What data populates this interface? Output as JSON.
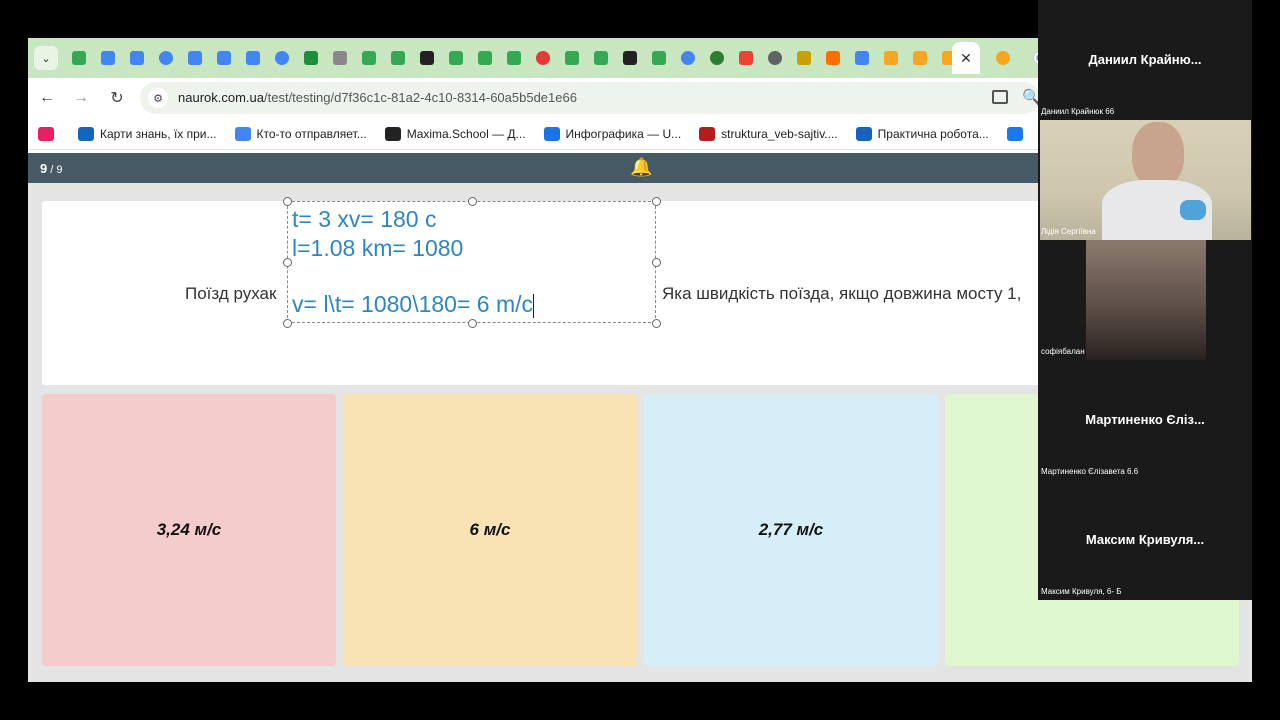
{
  "browser": {
    "tab_icons": [
      {
        "icon": "google-drive-icon",
        "color": "#34a853"
      },
      {
        "icon": "google-docs-icon",
        "color": "#4285f4"
      },
      {
        "icon": "google-docs-icon",
        "color": "#4285f4"
      },
      {
        "icon": "docs-circle-icon",
        "color": "#4285f4"
      },
      {
        "icon": "google-docs-icon",
        "color": "#4285f4"
      },
      {
        "icon": "google-docs-icon",
        "color": "#4285f4"
      },
      {
        "icon": "google-docs-icon",
        "color": "#4285f4"
      },
      {
        "icon": "docs-circle-icon",
        "color": "#4285f4"
      },
      {
        "icon": "green-plus-icon",
        "color": "#1e8e3e"
      },
      {
        "icon": "printer-icon",
        "color": "#888888"
      },
      {
        "icon": "google-drive-icon",
        "color": "#34a853"
      },
      {
        "icon": "google-drive-icon",
        "color": "#34a853"
      },
      {
        "icon": "d-letter-icon",
        "color": "#222222"
      },
      {
        "icon": "google-drive-icon",
        "color": "#34a853"
      },
      {
        "icon": "google-drive-icon",
        "color": "#34a853"
      },
      {
        "icon": "google-drive-icon",
        "color": "#34a853"
      },
      {
        "icon": "red-circle-icon",
        "color": "#e53935"
      },
      {
        "icon": "google-drive-icon",
        "color": "#34a853"
      },
      {
        "icon": "google-drive-icon",
        "color": "#34a853"
      },
      {
        "icon": "d-letter-icon",
        "color": "#222222"
      },
      {
        "icon": "google-drive-icon",
        "color": "#34a853"
      },
      {
        "icon": "docs-circle-icon",
        "color": "#4285f4"
      },
      {
        "icon": "loading-icon",
        "color": "#2e7d32"
      },
      {
        "icon": "gmail-icon",
        "color": "#ea4335"
      },
      {
        "icon": "globe-icon",
        "color": "#5f6368"
      },
      {
        "icon": "badge-icon",
        "color": "#c8a000"
      },
      {
        "icon": "grid-icon",
        "color": "#ff6f00"
      },
      {
        "icon": "google-g-icon",
        "color": "#4285f4"
      },
      {
        "icon": "bell-tab-icon",
        "color": "#f5a623"
      },
      {
        "icon": "bell-tab-icon",
        "color": "#f5a623"
      },
      {
        "icon": "bell-tab-icon",
        "color": "#f5a623"
      }
    ],
    "active_tab_close": "✕",
    "url_host": "naurok.com.ua",
    "url_path": "/test/testing/d7f36c1c-81a2-4c10-8314-60a5b5de1e66",
    "bookmarks": [
      {
        "label": "",
        "icon": "dna-icon",
        "color": "#e91e63"
      },
      {
        "label": "Карти знань, їх при...",
        "icon": "flag-icon",
        "color": "#1565c0"
      },
      {
        "label": "Кто-то отправляет...",
        "icon": "google-g-icon",
        "color": "#4285f4"
      },
      {
        "label": "Maxima.School — Д...",
        "icon": "maxima-icon",
        "color": "#222222"
      },
      {
        "label": "Инфографика — U...",
        "icon": "chrome-icon",
        "color": "#1a73e8"
      },
      {
        "label": "struktura_veb-sajtiv....",
        "icon": "pdf-icon",
        "color": "#b71c1c"
      },
      {
        "label": "Практична робота...",
        "icon": "window-icon",
        "color": "#1565c0"
      },
      {
        "label": "",
        "icon": "facebook-icon",
        "color": "#1877f2"
      }
    ]
  },
  "quiz": {
    "current": "9",
    "total": " / 9",
    "question_part1": "Поїзд рухак",
    "question_part2": "Яка швидкість поїзда, якщо довжина мосту 1,",
    "overlay_lines": [
      "t= 3 xv= 180 c",
      "l=1.08 km= 1080",
      "v= l\\t= 1080\\180= 6 m/c"
    ],
    "answers": [
      {
        "text": "3,24 м/с",
        "color": "#f4cccc"
      },
      {
        "text": "6 м/с",
        "color": "#f9e3b4"
      },
      {
        "text": "2,77 м/с",
        "color": "#d6eef8"
      },
      {
        "text": "",
        "color": "#dff7cf"
      }
    ]
  },
  "video_call": {
    "participants": [
      {
        "name": "Даниил Крайню...",
        "label": "Даниил Крайнюк 66",
        "video": false
      },
      {
        "name": "",
        "label": "Лідія Сергіївна",
        "video": true
      },
      {
        "name": "",
        "label": "софіябалан",
        "video": true
      },
      {
        "name": "Мартиненко Єліз...",
        "label": "Мартиненко Єлізавета 6.6",
        "video": false
      },
      {
        "name": "Максим Кривуля...",
        "label": "Максим Кривуля,  6- Б",
        "video": false
      }
    ]
  }
}
